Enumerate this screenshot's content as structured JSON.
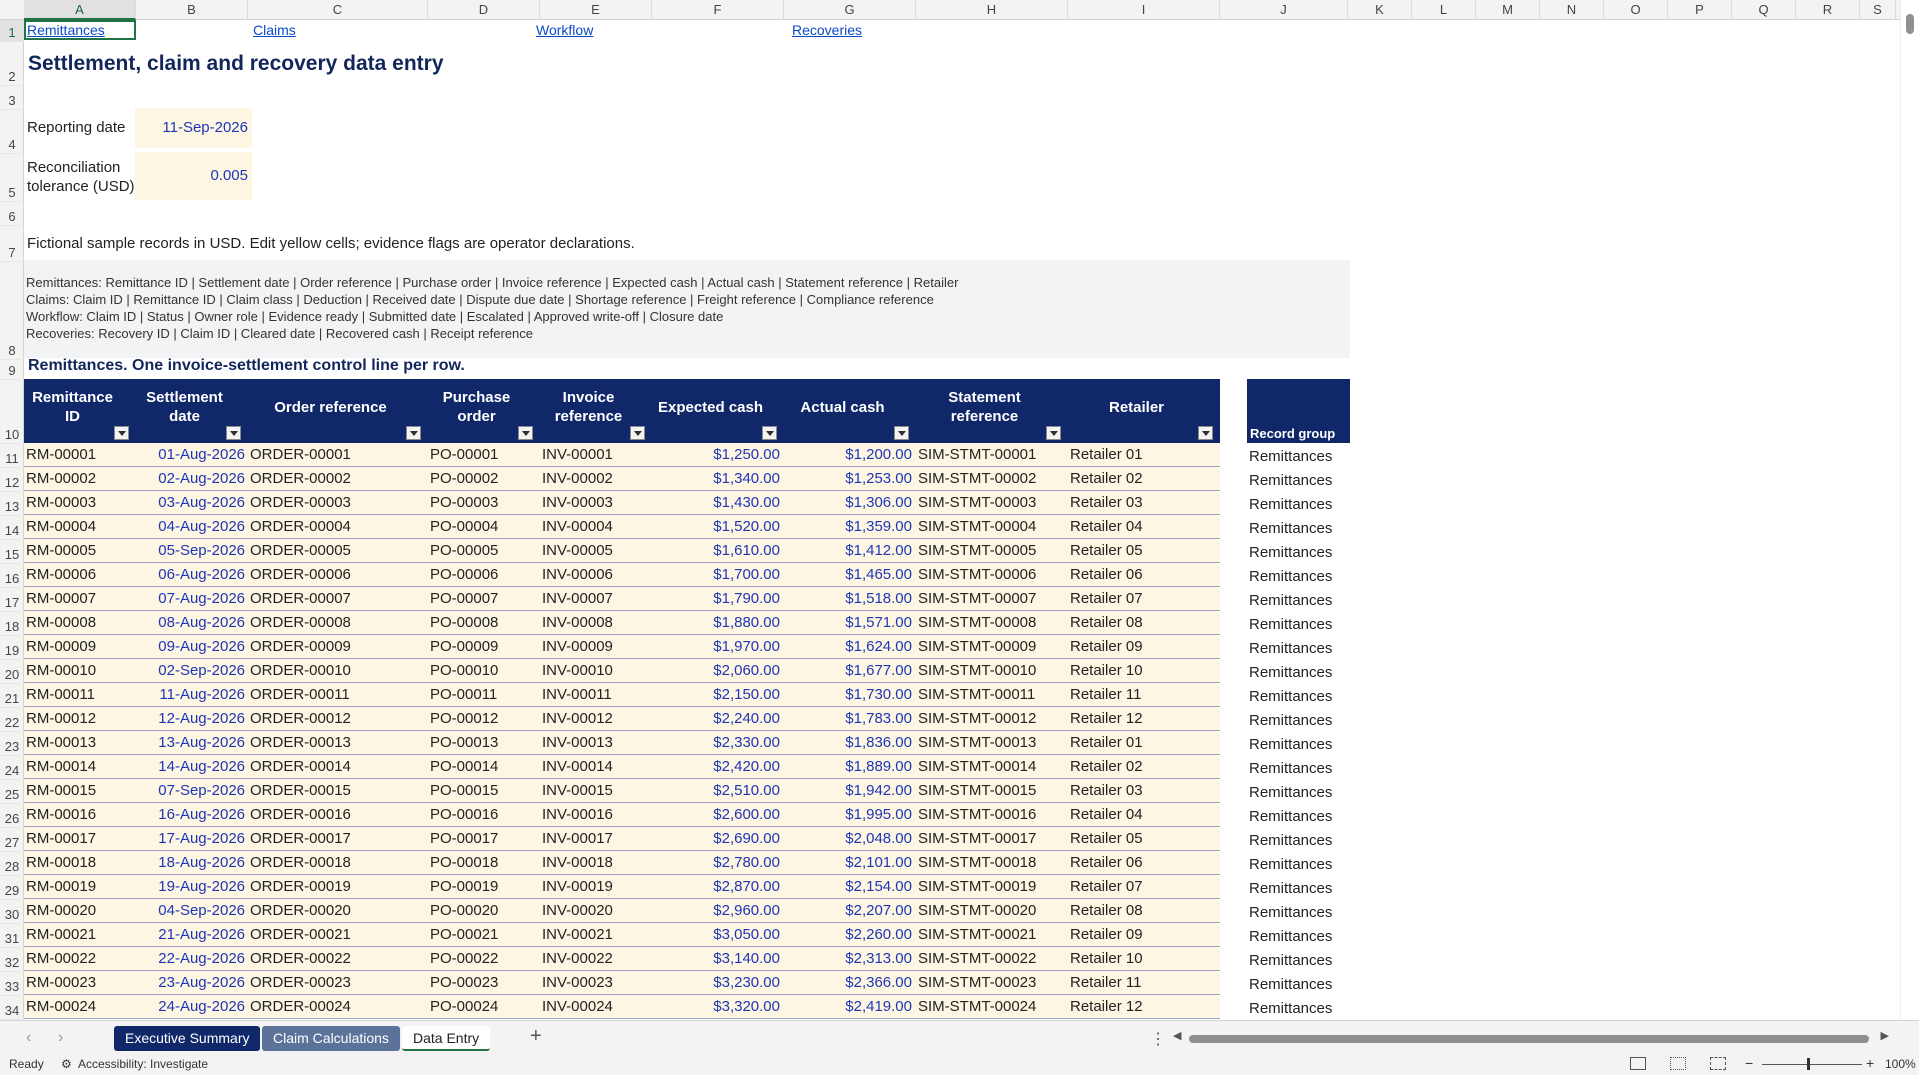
{
  "columns": [
    "A",
    "B",
    "C",
    "D",
    "E",
    "F",
    "G",
    "H",
    "I",
    "J",
    "K",
    "L",
    "M",
    "N",
    "O",
    "P",
    "Q",
    "R",
    "S"
  ],
  "nav_links": [
    "Remittances",
    "Claims",
    "Workflow",
    "Recoveries"
  ],
  "title": "Settlement, claim and recovery data entry",
  "params": {
    "reporting_date_label": "Reporting date",
    "reporting_date_value": "11-Sep-2026",
    "tolerance_label_1": "Reconciliation",
    "tolerance_label_2": "tolerance (USD)",
    "tolerance_value": "0.005"
  },
  "note": "Fictional sample records in USD. Edit yellow cells; evidence flags are operator declarations.",
  "schema_lines": [
    "Remittances: Remittance ID | Settlement date | Order reference | Purchase order | Invoice reference | Expected cash | Actual cash | Statement reference | Retailer",
    "Claims: Claim ID | Remittance ID | Claim class | Deduction | Received date | Dispute due date | Shortage reference | Freight reference | Compliance reference",
    "Workflow: Claim ID | Status | Owner role | Evidence ready | Submitted date | Escalated | Approved write-off | Closure date",
    "Recoveries: Recovery ID | Claim ID | Cleared date | Recovered cash | Receipt reference"
  ],
  "section_title": "Remittances. One invoice-settlement control line per row.",
  "table": {
    "headers": [
      "Remittance ID",
      "Settlement date",
      "Order reference",
      "Purchase order",
      "Invoice reference",
      "Expected cash",
      "Actual cash",
      "Statement reference",
      "Retailer"
    ],
    "record_group_header": "Record group",
    "record_group_value": "Remittances",
    "rows": [
      [
        "RM-00001",
        "01-Aug-2026",
        "ORDER-00001",
        "PO-00001",
        "INV-00001",
        "$1,250.00",
        "$1,200.00",
        "SIM-STMT-00001",
        "Retailer 01"
      ],
      [
        "RM-00002",
        "02-Aug-2026",
        "ORDER-00002",
        "PO-00002",
        "INV-00002",
        "$1,340.00",
        "$1,253.00",
        "SIM-STMT-00002",
        "Retailer 02"
      ],
      [
        "RM-00003",
        "03-Aug-2026",
        "ORDER-00003",
        "PO-00003",
        "INV-00003",
        "$1,430.00",
        "$1,306.00",
        "SIM-STMT-00003",
        "Retailer 03"
      ],
      [
        "RM-00004",
        "04-Aug-2026",
        "ORDER-00004",
        "PO-00004",
        "INV-00004",
        "$1,520.00",
        "$1,359.00",
        "SIM-STMT-00004",
        "Retailer 04"
      ],
      [
        "RM-00005",
        "05-Sep-2026",
        "ORDER-00005",
        "PO-00005",
        "INV-00005",
        "$1,610.00",
        "$1,412.00",
        "SIM-STMT-00005",
        "Retailer 05"
      ],
      [
        "RM-00006",
        "06-Aug-2026",
        "ORDER-00006",
        "PO-00006",
        "INV-00006",
        "$1,700.00",
        "$1,465.00",
        "SIM-STMT-00006",
        "Retailer 06"
      ],
      [
        "RM-00007",
        "07-Aug-2026",
        "ORDER-00007",
        "PO-00007",
        "INV-00007",
        "$1,790.00",
        "$1,518.00",
        "SIM-STMT-00007",
        "Retailer 07"
      ],
      [
        "RM-00008",
        "08-Aug-2026",
        "ORDER-00008",
        "PO-00008",
        "INV-00008",
        "$1,880.00",
        "$1,571.00",
        "SIM-STMT-00008",
        "Retailer 08"
      ],
      [
        "RM-00009",
        "09-Aug-2026",
        "ORDER-00009",
        "PO-00009",
        "INV-00009",
        "$1,970.00",
        "$1,624.00",
        "SIM-STMT-00009",
        "Retailer 09"
      ],
      [
        "RM-00010",
        "02-Sep-2026",
        "ORDER-00010",
        "PO-00010",
        "INV-00010",
        "$2,060.00",
        "$1,677.00",
        "SIM-STMT-00010",
        "Retailer 10"
      ],
      [
        "RM-00011",
        "11-Aug-2026",
        "ORDER-00011",
        "PO-00011",
        "INV-00011",
        "$2,150.00",
        "$1,730.00",
        "SIM-STMT-00011",
        "Retailer 11"
      ],
      [
        "RM-00012",
        "12-Aug-2026",
        "ORDER-00012",
        "PO-00012",
        "INV-00012",
        "$2,240.00",
        "$1,783.00",
        "SIM-STMT-00012",
        "Retailer 12"
      ],
      [
        "RM-00013",
        "13-Aug-2026",
        "ORDER-00013",
        "PO-00013",
        "INV-00013",
        "$2,330.00",
        "$1,836.00",
        "SIM-STMT-00013",
        "Retailer 01"
      ],
      [
        "RM-00014",
        "14-Aug-2026",
        "ORDER-00014",
        "PO-00014",
        "INV-00014",
        "$2,420.00",
        "$1,889.00",
        "SIM-STMT-00014",
        "Retailer 02"
      ],
      [
        "RM-00015",
        "07-Sep-2026",
        "ORDER-00015",
        "PO-00015",
        "INV-00015",
        "$2,510.00",
        "$1,942.00",
        "SIM-STMT-00015",
        "Retailer 03"
      ],
      [
        "RM-00016",
        "16-Aug-2026",
        "ORDER-00016",
        "PO-00016",
        "INV-00016",
        "$2,600.00",
        "$1,995.00",
        "SIM-STMT-00016",
        "Retailer 04"
      ],
      [
        "RM-00017",
        "17-Aug-2026",
        "ORDER-00017",
        "PO-00017",
        "INV-00017",
        "$2,690.00",
        "$2,048.00",
        "SIM-STMT-00017",
        "Retailer 05"
      ],
      [
        "RM-00018",
        "18-Aug-2026",
        "ORDER-00018",
        "PO-00018",
        "INV-00018",
        "$2,780.00",
        "$2,101.00",
        "SIM-STMT-00018",
        "Retailer 06"
      ],
      [
        "RM-00019",
        "19-Aug-2026",
        "ORDER-00019",
        "PO-00019",
        "INV-00019",
        "$2,870.00",
        "$2,154.00",
        "SIM-STMT-00019",
        "Retailer 07"
      ],
      [
        "RM-00020",
        "04-Sep-2026",
        "ORDER-00020",
        "PO-00020",
        "INV-00020",
        "$2,960.00",
        "$2,207.00",
        "SIM-STMT-00020",
        "Retailer 08"
      ],
      [
        "RM-00021",
        "21-Aug-2026",
        "ORDER-00021",
        "PO-00021",
        "INV-00021",
        "$3,050.00",
        "$2,260.00",
        "SIM-STMT-00021",
        "Retailer 09"
      ],
      [
        "RM-00022",
        "22-Aug-2026",
        "ORDER-00022",
        "PO-00022",
        "INV-00022",
        "$3,140.00",
        "$2,313.00",
        "SIM-STMT-00022",
        "Retailer 10"
      ],
      [
        "RM-00023",
        "23-Aug-2026",
        "ORDER-00023",
        "PO-00023",
        "INV-00023",
        "$3,230.00",
        "$2,366.00",
        "SIM-STMT-00023",
        "Retailer 11"
      ],
      [
        "RM-00024",
        "24-Aug-2026",
        "ORDER-00024",
        "PO-00024",
        "INV-00024",
        "$3,320.00",
        "$2,419.00",
        "SIM-STMT-00024",
        "Retailer 12"
      ]
    ]
  },
  "sheet_tabs": [
    "Executive Summary",
    "Claim Calculations",
    "Data Entry"
  ],
  "active_sheet": "Data Entry",
  "status": {
    "ready": "Ready",
    "accessibility": "Accessibility: Investigate",
    "zoom": "100%"
  }
}
